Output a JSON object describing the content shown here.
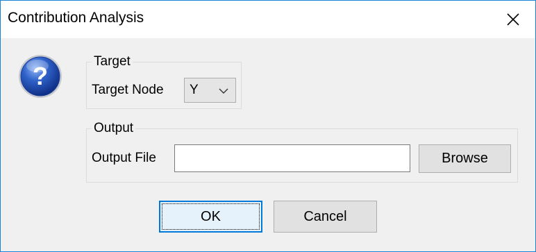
{
  "window": {
    "title": "Contribution Analysis",
    "close_icon": "close-icon"
  },
  "icon": {
    "name": "question-help-icon",
    "glyph": "?"
  },
  "target_group": {
    "legend": "Target",
    "node_label": "Target Node",
    "node_value": "Y"
  },
  "output_group": {
    "legend": "Output",
    "file_label": "Output File",
    "file_value": "",
    "browse_label": "Browse"
  },
  "buttons": {
    "ok_label": "OK",
    "cancel_label": "Cancel"
  },
  "colors": {
    "accent": "#0078d7",
    "window_border": "#1883d7",
    "dialog_bg": "#f0f0f0"
  }
}
